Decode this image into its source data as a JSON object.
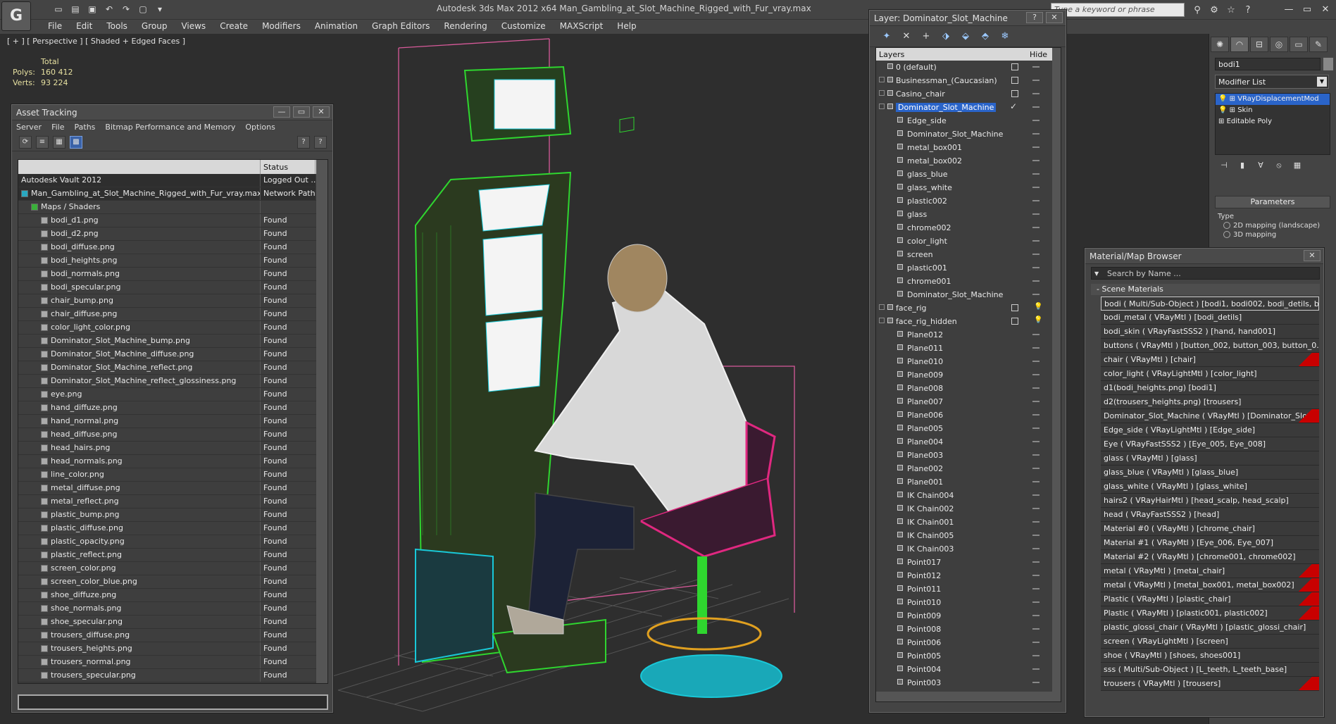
{
  "titlebar": {
    "app_logo": "G",
    "title": "Autodesk 3ds Max  2012 x64      Man_Gambling_at_Slot_Machine_Rigged_with_Fur_vray.max",
    "search_placeholder": "Type a keyword or phrase",
    "qat_icons": [
      "new-icon",
      "open-icon",
      "save-icon",
      "undo-icon",
      "redo-icon",
      "project-icon",
      "dropdown-icon"
    ]
  },
  "menu": [
    "File",
    "Edit",
    "Tools",
    "Group",
    "Views",
    "Create",
    "Modifiers",
    "Animation",
    "Graph Editors",
    "Rendering",
    "Customize",
    "MAXScript",
    "Help"
  ],
  "viewport": {
    "label": "[ + ] [ Perspective ] [ Shaded + Edged Faces ]",
    "stats_total": "Total",
    "polys_label": "Polys:",
    "polys": "160 412",
    "verts_label": "Verts:",
    "verts": "93 224"
  },
  "asset": {
    "title": "Asset Tracking",
    "menu": [
      "Server",
      "File",
      "Paths",
      "Bitmap Performance and Memory",
      "Options"
    ],
    "col_name": "",
    "col_status": "Status",
    "rows": [
      {
        "name": "Autodesk Vault 2012",
        "status": "Logged Out ..."
      },
      {
        "name": "Man_Gambling_at_Slot_Machine_Rigged_with_Fur_vray.max",
        "status": "Network Path"
      },
      {
        "name": "Maps / Shaders",
        "status": ""
      },
      {
        "name": "bodi_d1.png",
        "status": "Found"
      },
      {
        "name": "bodi_d2.png",
        "status": "Found"
      },
      {
        "name": "bodi_diffuse.png",
        "status": "Found"
      },
      {
        "name": "bodi_heights.png",
        "status": "Found"
      },
      {
        "name": "bodi_normals.png",
        "status": "Found"
      },
      {
        "name": "bodi_specular.png",
        "status": "Found"
      },
      {
        "name": "chair_bump.png",
        "status": "Found"
      },
      {
        "name": "chair_diffuse.png",
        "status": "Found"
      },
      {
        "name": "color_light_color.png",
        "status": "Found"
      },
      {
        "name": "Dominator_Slot_Machine_bump.png",
        "status": "Found"
      },
      {
        "name": "Dominator_Slot_Machine_diffuse.png",
        "status": "Found"
      },
      {
        "name": "Dominator_Slot_Machine_reflect.png",
        "status": "Found"
      },
      {
        "name": "Dominator_Slot_Machine_reflect_glossiness.png",
        "status": "Found"
      },
      {
        "name": "eye.png",
        "status": "Found"
      },
      {
        "name": "hand_diffuze.png",
        "status": "Found"
      },
      {
        "name": "hand_normal.png",
        "status": "Found"
      },
      {
        "name": "head_diffuse.png",
        "status": "Found"
      },
      {
        "name": "head_hairs.png",
        "status": "Found"
      },
      {
        "name": "head_normals.png",
        "status": "Found"
      },
      {
        "name": "line_color.png",
        "status": "Found"
      },
      {
        "name": "metal_diffuse.png",
        "status": "Found"
      },
      {
        "name": "metal_reflect.png",
        "status": "Found"
      },
      {
        "name": "plastic_bump.png",
        "status": "Found"
      },
      {
        "name": "plastic_diffuse.png",
        "status": "Found"
      },
      {
        "name": "plastic_opacity.png",
        "status": "Found"
      },
      {
        "name": "plastic_reflect.png",
        "status": "Found"
      },
      {
        "name": "screen_color.png",
        "status": "Found"
      },
      {
        "name": "screen_color_blue.png",
        "status": "Found"
      },
      {
        "name": "shoe_diffuze.png",
        "status": "Found"
      },
      {
        "name": "shoe_normals.png",
        "status": "Found"
      },
      {
        "name": "shoe_specular.png",
        "status": "Found"
      },
      {
        "name": "trousers_diffuse.png",
        "status": "Found"
      },
      {
        "name": "trousers_heights.png",
        "status": "Found"
      },
      {
        "name": "trousers_normal.png",
        "status": "Found"
      },
      {
        "name": "trousers_specular.png",
        "status": "Found"
      }
    ]
  },
  "layer": {
    "title": "Layer: Dominator_Slot_Machine",
    "col_layers": "Layers",
    "col_hide": "Hide",
    "rows": [
      {
        "name": "0 (default)",
        "indent": 0,
        "box": true
      },
      {
        "name": "Businessman_(Caucasian)",
        "indent": 0,
        "box": true,
        "expand": true
      },
      {
        "name": "Casino_chair",
        "indent": 0,
        "box": true,
        "expand": true
      },
      {
        "name": "Dominator_Slot_Machine",
        "indent": 0,
        "selected": true,
        "tick": true,
        "expand": true
      },
      {
        "name": "Edge_side",
        "indent": 1
      },
      {
        "name": "Dominator_Slot_Machine",
        "indent": 1
      },
      {
        "name": "metal_box001",
        "indent": 1
      },
      {
        "name": "metal_box002",
        "indent": 1
      },
      {
        "name": "glass_blue",
        "indent": 1
      },
      {
        "name": "glass_white",
        "indent": 1
      },
      {
        "name": "plastic002",
        "indent": 1
      },
      {
        "name": "glass",
        "indent": 1
      },
      {
        "name": "chrome002",
        "indent": 1
      },
      {
        "name": "color_light",
        "indent": 1
      },
      {
        "name": "screen",
        "indent": 1
      },
      {
        "name": "plastic001",
        "indent": 1
      },
      {
        "name": "chrome001",
        "indent": 1
      },
      {
        "name": "Dominator_Slot_Machine",
        "indent": 1
      },
      {
        "name": "face_rig",
        "indent": 0,
        "box": true,
        "bulb": true,
        "expand": true
      },
      {
        "name": "face_rig_hidden",
        "indent": 0,
        "box": true,
        "bulb": true,
        "expand": true
      },
      {
        "name": "Plane012",
        "indent": 1
      },
      {
        "name": "Plane011",
        "indent": 1
      },
      {
        "name": "Plane010",
        "indent": 1
      },
      {
        "name": "Plane009",
        "indent": 1
      },
      {
        "name": "Plane008",
        "indent": 1
      },
      {
        "name": "Plane007",
        "indent": 1
      },
      {
        "name": "Plane006",
        "indent": 1
      },
      {
        "name": "Plane005",
        "indent": 1
      },
      {
        "name": "Plane004",
        "indent": 1
      },
      {
        "name": "Plane003",
        "indent": 1
      },
      {
        "name": "Plane002",
        "indent": 1
      },
      {
        "name": "Plane001",
        "indent": 1
      },
      {
        "name": "IK Chain004",
        "indent": 1
      },
      {
        "name": "IK Chain002",
        "indent": 1
      },
      {
        "name": "IK Chain001",
        "indent": 1
      },
      {
        "name": "IK Chain005",
        "indent": 1
      },
      {
        "name": "IK Chain003",
        "indent": 1
      },
      {
        "name": "Point017",
        "indent": 1
      },
      {
        "name": "Point012",
        "indent": 1
      },
      {
        "name": "Point011",
        "indent": 1
      },
      {
        "name": "Point010",
        "indent": 1
      },
      {
        "name": "Point009",
        "indent": 1
      },
      {
        "name": "Point008",
        "indent": 1
      },
      {
        "name": "Point006",
        "indent": 1
      },
      {
        "name": "Point005",
        "indent": 1
      },
      {
        "name": "Point004",
        "indent": 1
      },
      {
        "name": "Point003",
        "indent": 1
      }
    ]
  },
  "cmd": {
    "object_name": "bodi1",
    "modifier_list": "Modifier List",
    "stack": [
      {
        "name": "VRayDisplacementMod",
        "selected": true
      },
      {
        "name": "Skin"
      },
      {
        "name": "Editable Poly"
      }
    ],
    "params_title": "Parameters",
    "type_label": "Type",
    "options": [
      "2D mapping (landscape)",
      "3D mapping"
    ]
  },
  "matb": {
    "title": "Material/Map Browser",
    "search_placeholder": "Search by Name ...",
    "section": "- Scene Materials",
    "rows": [
      {
        "t": "bodi  ( Multi/Sub-Object )  [bodi1, bodi002, bodi_detils, b...",
        "first": true
      },
      {
        "t": "bodi_metal  ( VRayMtl )  [bodi_detils]"
      },
      {
        "t": "bodi_skin  ( VRayFastSSS2 )  [hand, hand001]"
      },
      {
        "t": "buttons  ( VRayMtl )  [button_002, button_003, button_0..."
      },
      {
        "t": "chair  ( VRayMtl )  [chair]",
        "red": true
      },
      {
        "t": "color_light  ( VRayLightMtl )  [color_light]"
      },
      {
        "t": "d1(bodi_heights.png)  [bodi1]"
      },
      {
        "t": "d2(trousers_heights.png)  [trousers]"
      },
      {
        "t": "Dominator_Slot_Machine  ( VRayMtl )  [Dominator_Slot...",
        "red": true
      },
      {
        "t": "Edge_side  ( VRayLightMtl )  [Edge_side]"
      },
      {
        "t": "Eye  ( VRayFastSSS2 )  [Eye_005, Eye_008]"
      },
      {
        "t": "glass  ( VRayMtl )  [glass]"
      },
      {
        "t": "glass_blue  ( VRayMtl )  [glass_blue]"
      },
      {
        "t": "glass_white  ( VRayMtl )  [glass_white]"
      },
      {
        "t": "hairs2  ( VRayHairMtl )  [head_scalp, head_scalp]"
      },
      {
        "t": "head  ( VRayFastSSS2 )  [head]"
      },
      {
        "t": "Material #0  ( VRayMtl )  [chrome_chair]"
      },
      {
        "t": "Material #1  ( VRayMtl )  [Eye_006, Eye_007]"
      },
      {
        "t": "Material #2  ( VRayMtl )  [chrome001, chrome002]"
      },
      {
        "t": "metal  ( VRayMtl )  [metal_chair]",
        "red": true
      },
      {
        "t": "metal  ( VRayMtl )  [metal_box001, metal_box002]",
        "red": true
      },
      {
        "t": "Plastic  ( VRayMtl )  [plastic_chair]",
        "red": true
      },
      {
        "t": "Plastic  ( VRayMtl )  [plastic001, plastic002]",
        "red": true
      },
      {
        "t": "plastic_glossi_chair ( VRayMtl ) [plastic_glossi_chair]"
      },
      {
        "t": "screen  ( VRayLightMtl )  [screen]"
      },
      {
        "t": "shoe  ( VRayMtl )  [shoes, shoes001]"
      },
      {
        "t": "sss  ( Multi/Sub-Object )  [L_teeth, L_teeth_base]"
      },
      {
        "t": "trousers  ( VRayMtl )  [trousers]",
        "red": true
      }
    ]
  },
  "colors": {
    "selection": "#2a64c9",
    "wire_green": "#2fd62f",
    "wire_cyan": "#19c8d8",
    "wire_pink": "#e02880",
    "wire_white": "#f0f0f0",
    "bbox_pink": "#d85a9a"
  }
}
